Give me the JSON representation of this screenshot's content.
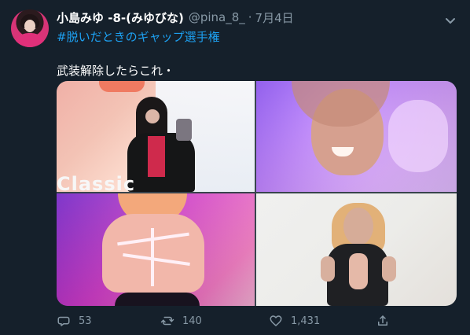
{
  "tweet": {
    "author_name": "小島みゆ -8-(みゆびな)",
    "handle": "@pina_8_",
    "separator": "·",
    "date": "7月4日",
    "hashtag": "#脱いだときのギャップ選手権",
    "text": "武装解除したらこれ・"
  },
  "media": {
    "photos": [
      {
        "label": "Classic"
      },
      {
        "label": ""
      },
      {
        "label": ""
      },
      {
        "label": ""
      }
    ]
  },
  "actions": {
    "reply_count": "53",
    "retweet_count": "140",
    "like_count": "1,431"
  },
  "colors": {
    "background": "#15202b",
    "text": "#ffffff",
    "muted": "#8899a6",
    "link": "#1da1f2"
  },
  "icons": {
    "reply": "reply-icon",
    "retweet": "retweet-icon",
    "like": "heart-icon",
    "share": "share-icon",
    "menu": "chevron-down-icon"
  }
}
